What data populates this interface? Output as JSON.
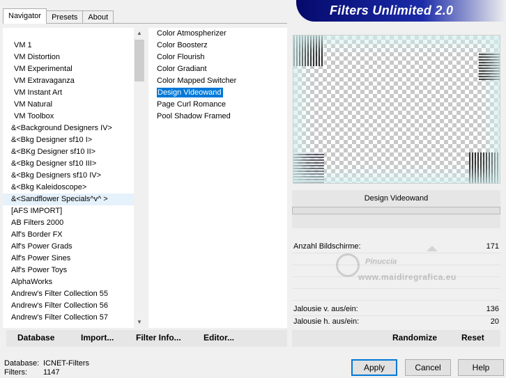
{
  "window": {
    "banner_title": "Filters Unlimited 2.0"
  },
  "tabs": [
    {
      "label": "Navigator",
      "active": true
    },
    {
      "label": "Presets",
      "active": false
    },
    {
      "label": "About",
      "active": false
    }
  ],
  "categories": [
    "VM 1",
    "VM Distortion",
    "VM Experimental",
    "VM Extravaganza",
    "VM Instant Art",
    "VM Natural",
    "VM Toolbox",
    "&<Background Designers IV>",
    "&<Bkg Designer sf10 I>",
    "&<BKg Designer sf10 II>",
    "&<Bkg Designer sf10 III>",
    "&<Bkg Designers sf10 IV>",
    "&<Bkg Kaleidoscope>",
    "&<Sandflower Specials^v^ >",
    "[AFS IMPORT]",
    "AB Filters 2000",
    "Alf's Border FX",
    "Alf's Power Grads",
    "Alf's Power Sines",
    "Alf's Power Toys",
    "AlphaWorks",
    "Andrew's Filter Collection 55",
    "Andrew's Filter Collection 56",
    "Andrew's Filter Collection 57"
  ],
  "filters": [
    "Color Atmospherizer",
    "Color Boosterz",
    "Color Flourish",
    "Color Gradiant",
    "Color Mapped Switcher",
    "Design Videowand",
    "Page Curl Romance",
    "Pool Shadow Framed"
  ],
  "selected_filter_index": 5,
  "current_filter_name": "Design Videowand",
  "params": [
    {
      "label": "Anzahl Bildschirme:",
      "value": "171"
    },
    {
      "label": "Jalousie v. aus/ein:",
      "value": "136"
    },
    {
      "label": "Jalousie h. aus/ein:",
      "value": "20"
    }
  ],
  "watermark": {
    "name": "Pinuccia",
    "url": "www.maidiregrafica.eu"
  },
  "toolbar_left": {
    "database": "Database",
    "import": "Import...",
    "filter_info": "Filter Info...",
    "editor": "Editor..."
  },
  "toolbar_right": {
    "randomize": "Randomize",
    "reset": "Reset"
  },
  "status": {
    "database_label": "Database:",
    "database_value": "ICNET-Filters",
    "filters_label": "Filters:",
    "filters_value": "1147"
  },
  "dialog_buttons": {
    "apply": "Apply",
    "cancel": "Cancel",
    "help": "Help"
  }
}
